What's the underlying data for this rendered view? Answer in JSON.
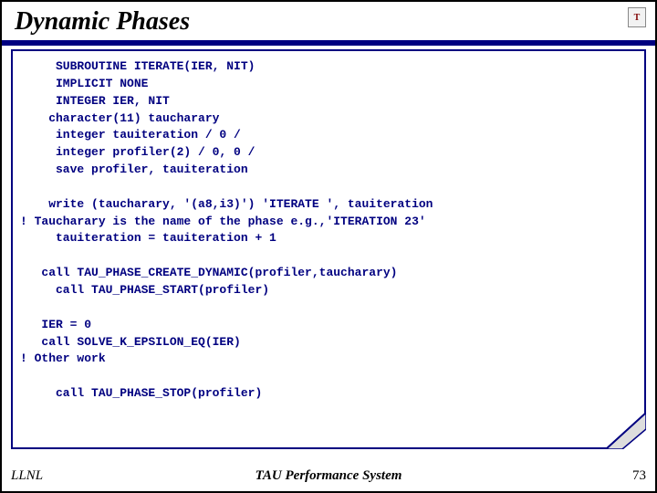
{
  "slide": {
    "title": "Dynamic Phases",
    "logo_letter": "T",
    "code": "     SUBROUTINE ITERATE(IER, NIT)\n     IMPLICIT NONE\n     INTEGER IER, NIT\n    character(11) taucharary\n     integer tauiteration / 0 /\n     integer profiler(2) / 0, 0 /\n     save profiler, tauiteration\n\n    write (taucharary, '(a8,i3)') 'ITERATE ', tauiteration\n! Taucharary is the name of the phase e.g.,'ITERATION 23'\n     tauiteration = tauiteration + 1\n\n   call TAU_PHASE_CREATE_DYNAMIC(profiler,taucharary)\n     call TAU_PHASE_START(profiler)\n\n   IER = 0\n   call SOLVE_K_EPSILON_EQ(IER)\n! Other work\n\n     call TAU_PHASE_STOP(profiler)",
    "footer_left": "LLNL",
    "footer_center": "TAU Performance System",
    "page_number": "73"
  }
}
